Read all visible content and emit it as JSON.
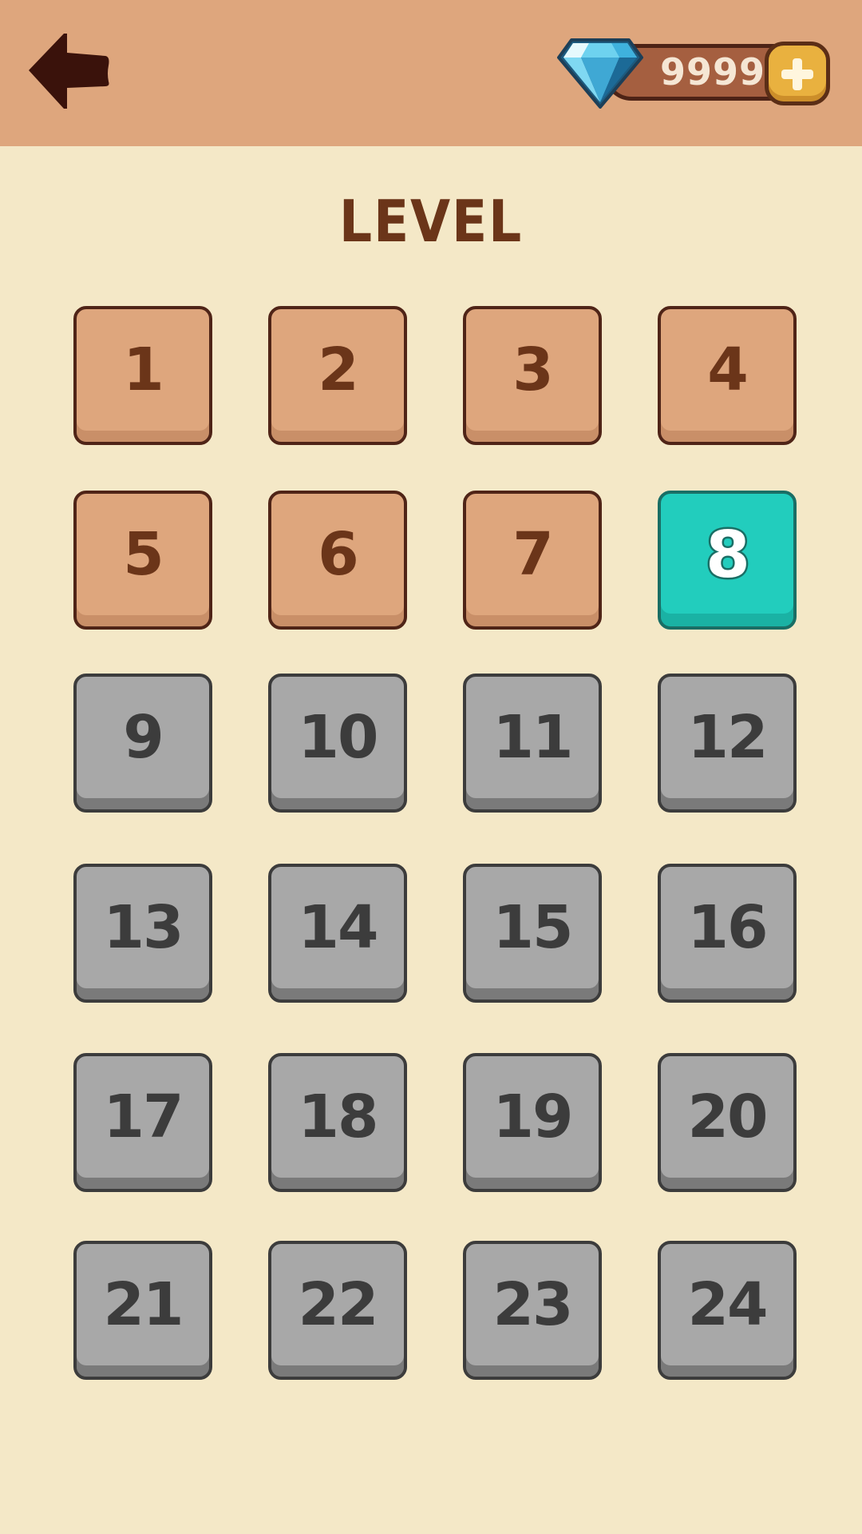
{
  "header": {
    "back_icon": "back-arrow-icon",
    "currency": {
      "icon": "diamond-gem-icon",
      "value": "9999",
      "add_icon": "plus-icon"
    }
  },
  "title": "LEVEL",
  "colors": {
    "header_bg": "#dea67d",
    "page_bg": "#f4e8c7",
    "completed_tile": "#dea67d",
    "current_tile": "#22cdbd",
    "locked_tile": "#a8a8a8",
    "title_text": "#6b3519"
  },
  "levels": [
    {
      "label": "1",
      "state": "completed"
    },
    {
      "label": "2",
      "state": "completed"
    },
    {
      "label": "3",
      "state": "completed"
    },
    {
      "label": "4",
      "state": "completed"
    },
    {
      "label": "5",
      "state": "completed"
    },
    {
      "label": "6",
      "state": "completed"
    },
    {
      "label": "7",
      "state": "completed"
    },
    {
      "label": "8",
      "state": "current"
    },
    {
      "label": "9",
      "state": "locked"
    },
    {
      "label": "10",
      "state": "locked"
    },
    {
      "label": "11",
      "state": "locked"
    },
    {
      "label": "12",
      "state": "locked"
    },
    {
      "label": "13",
      "state": "locked"
    },
    {
      "label": "14",
      "state": "locked"
    },
    {
      "label": "15",
      "state": "locked"
    },
    {
      "label": "16",
      "state": "locked"
    },
    {
      "label": "17",
      "state": "locked"
    },
    {
      "label": "18",
      "state": "locked"
    },
    {
      "label": "19",
      "state": "locked"
    },
    {
      "label": "20",
      "state": "locked"
    },
    {
      "label": "21",
      "state": "locked"
    },
    {
      "label": "22",
      "state": "locked"
    },
    {
      "label": "23",
      "state": "locked"
    },
    {
      "label": "24",
      "state": "locked"
    }
  ]
}
